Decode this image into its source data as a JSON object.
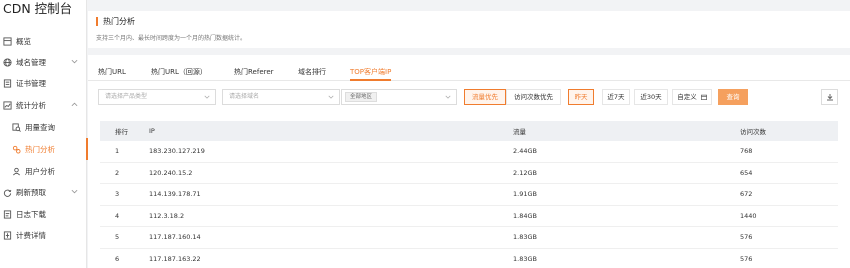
{
  "app": {
    "title": "CDN 控制台"
  },
  "sidebar": {
    "items": [
      {
        "label": "概览",
        "icon": "overview-icon"
      },
      {
        "label": "域名管理",
        "icon": "globe-icon",
        "expandable": true
      },
      {
        "label": "证书管理",
        "icon": "certificate-icon"
      },
      {
        "label": "统计分析",
        "icon": "chart-icon",
        "expandable": true,
        "expanded": true
      },
      {
        "label": "用量查询",
        "icon": "usage-search-icon",
        "sub": true
      },
      {
        "label": "热门分析",
        "icon": "hot-analysis-icon",
        "sub": true,
        "active": true
      },
      {
        "label": "用户分析",
        "icon": "user-icon",
        "sub": true
      },
      {
        "label": "刷新预取",
        "icon": "refresh-icon",
        "expandable": true
      },
      {
        "label": "日志下载",
        "icon": "log-icon"
      },
      {
        "label": "计费详情",
        "icon": "billing-icon"
      }
    ]
  },
  "header": {
    "title": "热门分析",
    "description": "支持三个月内、最长时间跨度为一个月的热门数据统计。"
  },
  "tabs": [
    {
      "label": "热门URL",
      "active": false
    },
    {
      "label": "热门URL（回源）",
      "active": false
    },
    {
      "label": "热门Referer",
      "active": false
    },
    {
      "label": "域名排行",
      "active": false
    },
    {
      "label": "TOP客户端IP",
      "active": true
    }
  ],
  "filters": {
    "product_placeholder": "请选择产品类型",
    "domain_placeholder": "请选择域名",
    "region_tag": "全部地区",
    "sort_by_flow": "流量优先",
    "sort_by_visits": "访问次数优先",
    "today": "昨天",
    "last7": "近7天",
    "last30": "近30天",
    "custom": "自定义",
    "query": "查询"
  },
  "table": {
    "columns": [
      "排行",
      "IP",
      "流量",
      "访问次数"
    ],
    "rows": [
      {
        "rank": "1",
        "ip": "183.230.127.219",
        "flow": "2.44GB",
        "visits": "768"
      },
      {
        "rank": "2",
        "ip": "120.240.15.2",
        "flow": "2.12GB",
        "visits": "654"
      },
      {
        "rank": "3",
        "ip": "114.139.178.71",
        "flow": "1.91GB",
        "visits": "672"
      },
      {
        "rank": "4",
        "ip": "112.3.18.2",
        "flow": "1.84GB",
        "visits": "1440"
      },
      {
        "rank": "5",
        "ip": "117.187.160.14",
        "flow": "1.83GB",
        "visits": "576"
      },
      {
        "rank": "6",
        "ip": "117.187.163.22",
        "flow": "1.83GB",
        "visits": "576"
      }
    ]
  },
  "colors": {
    "accent": "#f07c2e",
    "header_bg": "#eef0f3"
  }
}
